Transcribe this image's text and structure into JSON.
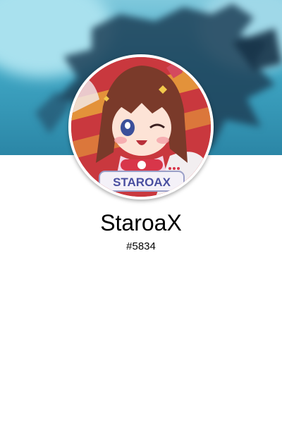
{
  "profile": {
    "username": "StaroaX",
    "discriminator": "#5834",
    "avatar_badge_text": "STAROAX"
  },
  "icons": {
    "avatar": "anime-girl-avatar",
    "banner": "blue-dragon-banner"
  },
  "colors": {
    "banner_primary": "#3fa6c4",
    "avatar_background": "#c9383e",
    "text": "#000000",
    "card_background": "#ffffff"
  }
}
